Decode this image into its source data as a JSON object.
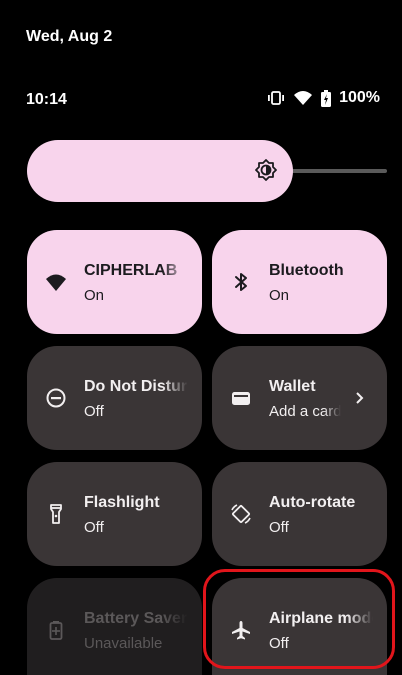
{
  "status_bar": {
    "date": "Wed, Aug 2",
    "time": "10:14",
    "battery": "100%"
  },
  "brightness": {
    "level": 0.76
  },
  "tiles": [
    {
      "label": "CIPHERLAB",
      "state": "On",
      "icon": "wifi-icon",
      "status": "on"
    },
    {
      "label": "Bluetooth",
      "state": "On",
      "icon": "bluetooth-icon",
      "status": "on"
    },
    {
      "label": "Do Not Disturb",
      "state": "Off",
      "icon": "do-not-disturb-icon",
      "status": "off"
    },
    {
      "label": "Wallet",
      "state": "Add a card",
      "icon": "wallet-icon",
      "status": "off"
    },
    {
      "label": "Flashlight",
      "state": "Off",
      "icon": "flashlight-icon",
      "status": "off"
    },
    {
      "label": "Auto-rotate",
      "state": "Off",
      "icon": "auto-rotate-icon",
      "status": "off"
    },
    {
      "label": "Battery Saver",
      "state": "Unavailable",
      "icon": "battery-saver-icon",
      "status": "unavailable"
    },
    {
      "label": "Airplane mode",
      "state": "Off",
      "icon": "airplane-icon",
      "status": "off"
    }
  ],
  "colors": {
    "tile_on": "#f8d4ec",
    "tile_off": "#3a3536",
    "tile_unavailable": "#201e1f",
    "highlight": "#e1151b"
  }
}
